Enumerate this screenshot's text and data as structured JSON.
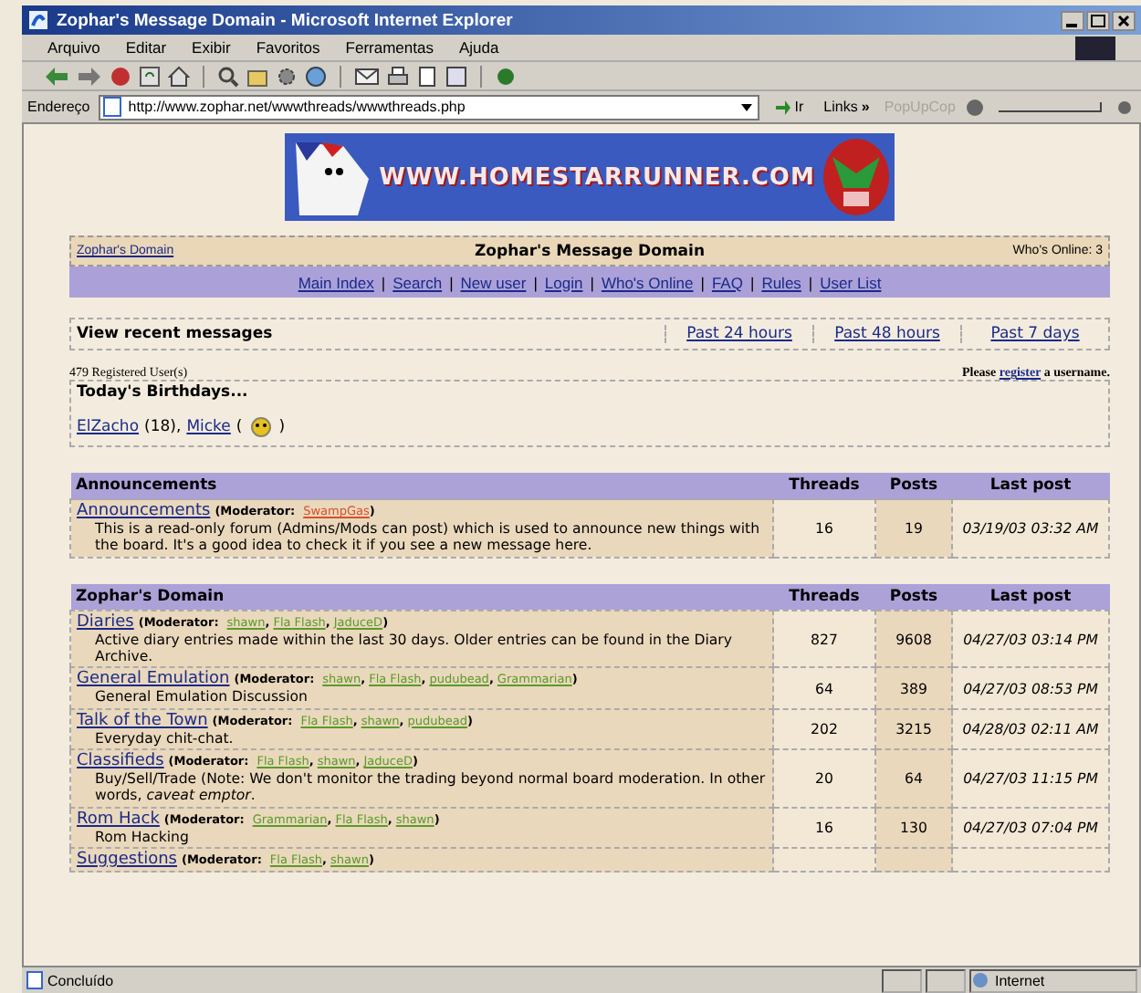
{
  "window": {
    "title": "Zophar's Message Domain - Microsoft Internet Explorer"
  },
  "menu": [
    "Arquivo",
    "Editar",
    "Exibir",
    "Favoritos",
    "Ferramentas",
    "Ajuda"
  ],
  "address_bar": {
    "label": "Endereço",
    "url": "http://www.zophar.net/wwwthreads/wwwthreads.php",
    "go": "Ir",
    "links": "Links",
    "links_more": "»",
    "toolbar_name": "PopUpCop"
  },
  "banner": {
    "text": "WWW.HOMESTARRUNNER.COM"
  },
  "header": {
    "home_link": "Zophar's Domain",
    "title": "Zophar's Message Domain",
    "online": "Who's Online: 3"
  },
  "nav_separator": "|",
  "nav": [
    "Main Index",
    "Search",
    "New user",
    "Login",
    "Who's Online",
    "FAQ",
    "Rules",
    "User List"
  ],
  "recent": {
    "label": "View recent messages",
    "links": [
      "Past 24 hours",
      "Past 48 hours",
      "Past 7 days"
    ]
  },
  "registered": "479 Registered User(s)",
  "register_prompt": {
    "before": "Please",
    "link": "register",
    "after": "a username."
  },
  "birthdays": {
    "title": "Today's Birthdays...",
    "parts": [
      {
        "kind": "link",
        "text": "ElZacho"
      },
      {
        "kind": "text",
        "text": "(18),"
      },
      {
        "kind": "link",
        "text": "Micke"
      },
      {
        "kind": "text",
        "text": "("
      },
      {
        "kind": "icon"
      },
      {
        "kind": "text",
        "text": ")"
      }
    ]
  },
  "sections": [
    {
      "title": "Announcements",
      "columns": [
        "Threads",
        "Posts",
        "Last post"
      ],
      "rows": [
        {
          "name": "Announcements",
          "moderator_label": "(Moderator:",
          "moderators": [
            {
              "name": "SwampGas",
              "color": "#d8502a",
              "after": ")"
            }
          ],
          "description": "This is a read-only forum (Admins/Mods can post) which is used to announce new things with the board. It's a good idea to check it if you see a new message here.",
          "threads": "16",
          "posts": "19",
          "last_post": "03/19/03 03:32 AM"
        }
      ]
    },
    {
      "title": "Zophar's Domain",
      "columns": [
        "Threads",
        "Posts",
        "Last post"
      ],
      "rows": [
        {
          "name": "Diaries",
          "moderator_label": "(Moderator:",
          "moderators": [
            {
              "name": "shawn",
              "color": "#5a9a2a",
              "after": ","
            },
            {
              "name": "Fla Flash",
              "color": "#5a9a2a",
              "after": ","
            },
            {
              "name": "JaduceD",
              "color": "#5a9a2a",
              "after": ")"
            }
          ],
          "description": "Active diary entries made within the last 30 days. Older entries can be found in the Diary Archive.",
          "threads": "827",
          "posts": "9608",
          "last_post": "04/27/03 03:14 PM"
        },
        {
          "name": "General Emulation",
          "moderator_label": "(Moderator:",
          "moderators": [
            {
              "name": "shawn",
              "color": "#5a9a2a",
              "after": ","
            },
            {
              "name": "Fla Flash",
              "color": "#5a9a2a",
              "after": ","
            },
            {
              "name": "pudubead",
              "color": "#5a9a2a",
              "after": ","
            },
            {
              "name": "Grammarian",
              "color": "#5a9a2a",
              "after": ")"
            }
          ],
          "description": "General Emulation Discussion",
          "threads": "64",
          "posts": "389",
          "last_post": "04/27/03 08:53 PM"
        },
        {
          "name": "Talk of the Town",
          "moderator_label": "(Moderator:",
          "moderators": [
            {
              "name": "Fla Flash",
              "color": "#5a9a2a",
              "after": ","
            },
            {
              "name": "shawn",
              "color": "#5a9a2a",
              "after": ","
            },
            {
              "name": "pudubead",
              "color": "#5a9a2a",
              "after": ")"
            }
          ],
          "description": "Everyday chit-chat.",
          "threads": "202",
          "posts": "3215",
          "last_post": "04/28/03 02:11 AM"
        },
        {
          "name": "Classifieds",
          "moderator_label": "(Moderator:",
          "moderators": [
            {
              "name": "Fla Flash",
              "color": "#5a9a2a",
              "after": ","
            },
            {
              "name": "shawn",
              "color": "#5a9a2a",
              "after": ","
            },
            {
              "name": "JaduceD",
              "color": "#5a9a2a",
              "after": ")"
            }
          ],
          "description": "Buy/Sell/Trade (Note: We don't monitor the trading beyond normal board moderation. In other words, *caveat emptor*.",
          "threads": "20",
          "posts": "64",
          "last_post": "04/27/03 11:15 PM"
        },
        {
          "name": "Rom Hack",
          "moderator_label": "(Moderator:",
          "moderators": [
            {
              "name": "Grammarian",
              "color": "#5a9a2a",
              "after": ","
            },
            {
              "name": "Fla Flash",
              "color": "#5a9a2a",
              "after": ","
            },
            {
              "name": "shawn",
              "color": "#5a9a2a",
              "after": ")"
            }
          ],
          "description": "Rom Hacking",
          "threads": "16",
          "posts": "130",
          "last_post": "04/27/03 07:04 PM"
        },
        {
          "name": "Suggestions",
          "moderator_label": "(Moderator:",
          "moderators": [
            {
              "name": "Fla Flash",
              "color": "#5a9a2a",
              "after": ","
            },
            {
              "name": "shawn",
              "color": "#5a9a2a",
              "after": ")"
            }
          ]
        }
      ]
    }
  ],
  "status_bar": {
    "text": "Concluído",
    "zone": "Internet"
  }
}
